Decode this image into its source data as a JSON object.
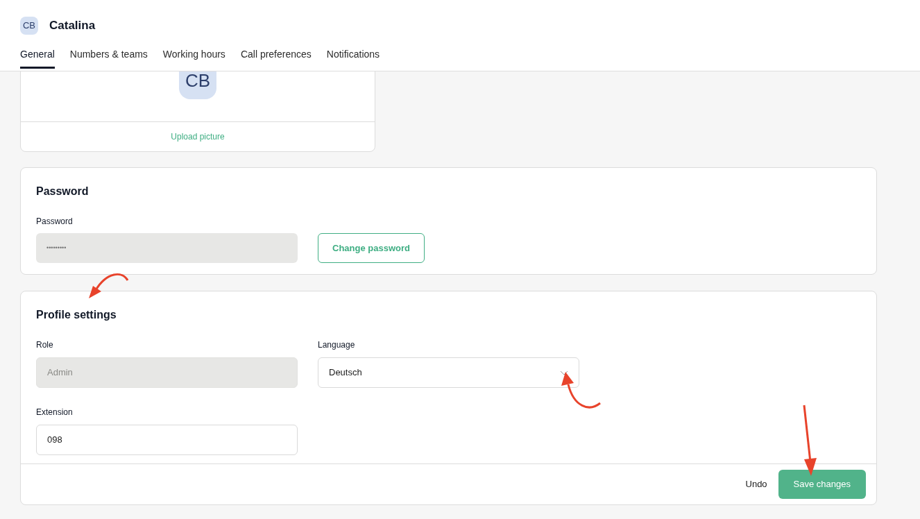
{
  "header": {
    "avatar_initials": "CB",
    "name": "Catalina"
  },
  "tabs": [
    {
      "label": "General",
      "selected": true
    },
    {
      "label": "Numbers & teams",
      "selected": false
    },
    {
      "label": "Working hours",
      "selected": false
    },
    {
      "label": "Call preferences",
      "selected": false
    },
    {
      "label": "Notifications",
      "selected": false
    }
  ],
  "picture_card": {
    "avatar_initials": "CB",
    "upload_link": "Upload picture"
  },
  "password_card": {
    "title": "Password",
    "field_label": "Password",
    "field_value": "•••••••••",
    "disabled": true,
    "button": "Change password"
  },
  "profile_card": {
    "title": "Profile settings",
    "fields": [
      {
        "kind": "input",
        "label": "Role",
        "value": "Admin",
        "disabled": true
      },
      {
        "kind": "select",
        "label": "Language",
        "value": "Deutsch",
        "disabled": false
      },
      {
        "kind": "input",
        "label": "Extension",
        "value": "098",
        "disabled": false
      }
    ],
    "undo": "Undo",
    "save": "Save changes"
  }
}
